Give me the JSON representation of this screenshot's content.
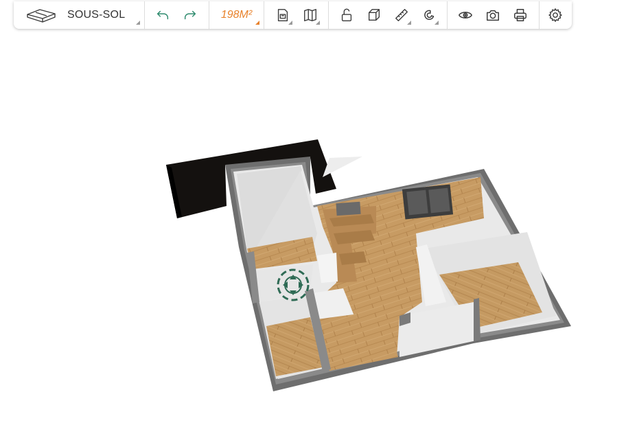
{
  "toolbar": {
    "level": {
      "label": "SOUS-SOL",
      "icon": "floor-level-icon"
    },
    "history": [
      {
        "name": "undo-button",
        "icon": "undo-arrow-icon"
      },
      {
        "name": "redo-button",
        "icon": "redo-arrow-icon"
      }
    ],
    "area": {
      "label": "198M²"
    },
    "colors": {
      "accent": "#e8822c",
      "teal": "#2e8b6e",
      "icon": "#3a3a3a"
    }
  },
  "viewport": {
    "type": "3d-floor-plan",
    "rotate_cursor_icon": "rotate-arrows-icon"
  }
}
